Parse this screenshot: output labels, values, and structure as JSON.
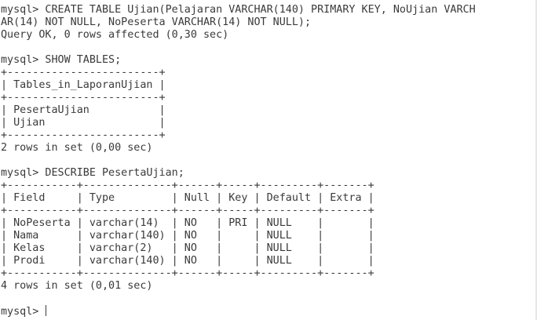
{
  "terminal": {
    "blocks": [
      [
        "mysql> CREATE TABLE Ujian(Pelajaran VARCHAR(140) PRIMARY KEY, NoUjian VARCH",
        "AR(14) NOT NULL, NoPeserta VARCHAR(14) NOT NULL);",
        "Query OK, 0 rows affected (0,30 sec)"
      ],
      [
        "mysql> SHOW TABLES;",
        "+------------------------+",
        "| Tables_in_LaporanUjian |",
        "+------------------------+",
        "| PesertaUjian           |",
        "| Ujian                  |",
        "+------------------------+",
        "2 rows in set (0,00 sec)"
      ],
      [
        "mysql> DESCRIBE PesertaUjian;",
        "+-----------+--------------+------+-----+---------+-------+",
        "| Field     | Type         | Null | Key | Default | Extra |",
        "+-----------+--------------+------+-----+---------+-------+",
        "| NoPeserta | varchar(14)  | NO   | PRI | NULL    |       |",
        "| Nama      | varchar(140) | NO   |     | NULL    |       |",
        "| Kelas     | varchar(2)   | NO   |     | NULL    |       |",
        "| Prodi     | varchar(140) | NO   |     | NULL    |       |",
        "+-----------+--------------+------+-----+---------+-------+",
        "4 rows in set (0,01 sec)"
      ]
    ],
    "prompt": "mysql> "
  }
}
